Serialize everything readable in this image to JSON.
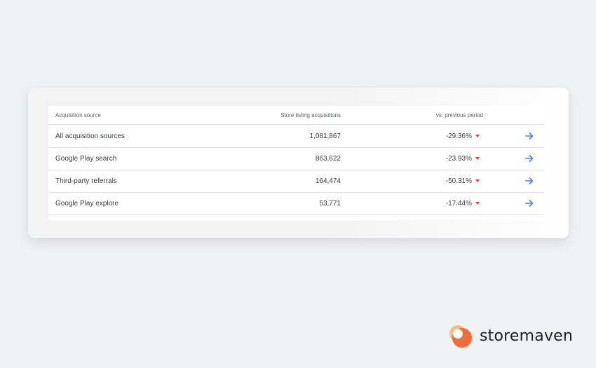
{
  "table": {
    "headers": {
      "source": "Acquisition source",
      "acquisitions": "Store listing acquisitions",
      "vs_previous": "vs. previous period"
    },
    "rows": [
      {
        "source": "All acquisition sources",
        "acquisitions": "1,081,867",
        "change": "-29.36%"
      },
      {
        "source": "Google Play search",
        "acquisitions": "863,622",
        "change": "-23.93%"
      },
      {
        "source": "Third-party referrals",
        "acquisitions": "164,474",
        "change": "-50.31%"
      },
      {
        "source": "Google Play explore",
        "acquisitions": "53,771",
        "change": "-17.44%"
      }
    ],
    "row_action_icon": "arrow-right-icon",
    "change_indicator_icon": "triangle-down-icon"
  },
  "colors": {
    "negative": "#e53935",
    "link": "#4285f4",
    "brand_orange": "#f26b3a"
  },
  "brand": {
    "name": "storemaven",
    "logo_icon": "storemaven-logo-icon"
  }
}
